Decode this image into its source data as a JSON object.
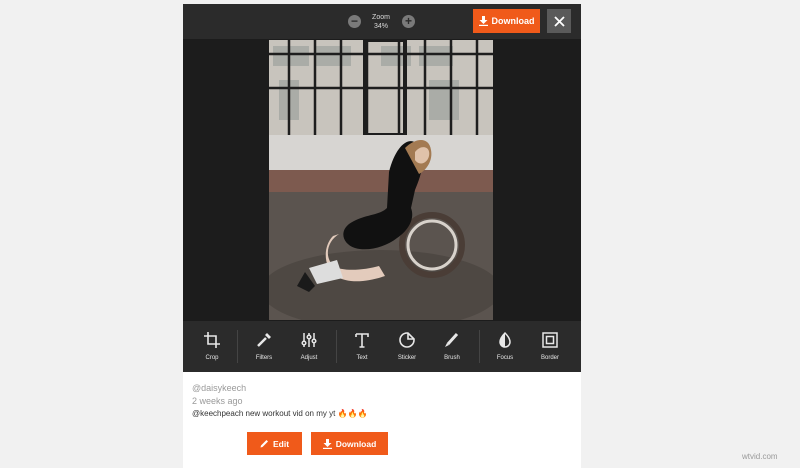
{
  "topbar": {
    "zoom_label": "Zoom",
    "zoom_value": "34%",
    "download_label": "Download"
  },
  "tools": [
    {
      "label": "Crop",
      "icon": "crop-icon"
    },
    {
      "label": "Filters",
      "icon": "filters-icon"
    },
    {
      "label": "Adjust",
      "icon": "adjust-icon"
    },
    {
      "label": "Text",
      "icon": "text-icon"
    },
    {
      "label": "Sticker",
      "icon": "sticker-icon"
    },
    {
      "label": "Brush",
      "icon": "brush-icon"
    },
    {
      "label": "Focus",
      "icon": "focus-icon"
    },
    {
      "label": "Border",
      "icon": "border-icon"
    }
  ],
  "post": {
    "username": "@daisykeech",
    "time": "2 weeks ago",
    "caption": "@keechpeach new workout vid on my yt 🔥🔥🔥"
  },
  "actions": {
    "edit_label": "Edit",
    "download_label": "Download"
  },
  "watermark": "wtvid.com",
  "colors": {
    "accent": "#f05a1a",
    "toolbar": "#2b2b2b",
    "stage": "#1c1c1c"
  }
}
